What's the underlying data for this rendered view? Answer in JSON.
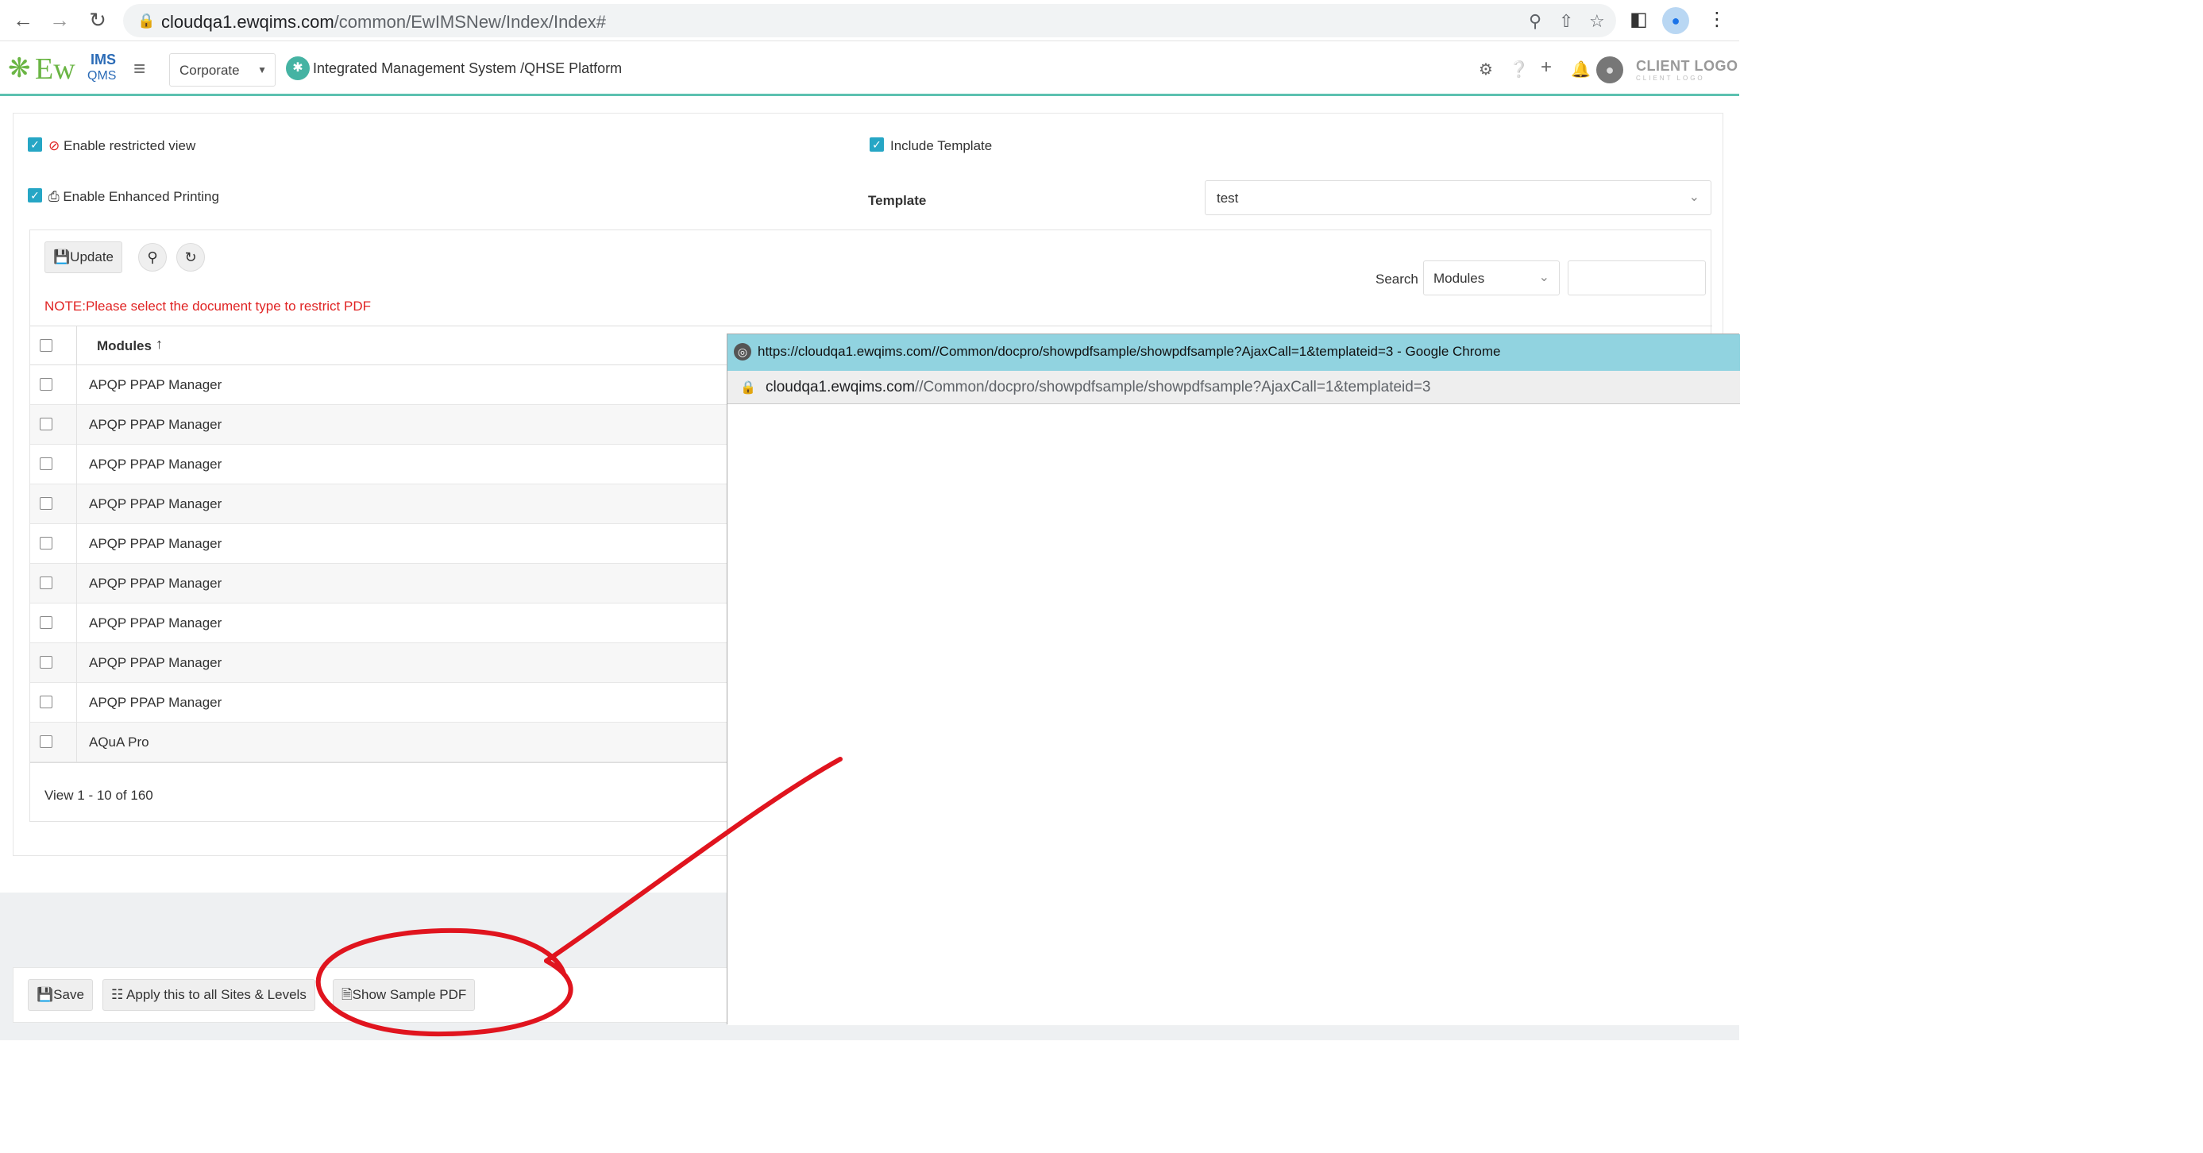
{
  "browser": {
    "url_host": "cloudqa1.ewqims.com",
    "url_path": "/common/EwIMSNew/Index/Index#"
  },
  "app": {
    "logo": {
      "ew": "Ew",
      "ims": "IMS",
      "qms": "QMS"
    },
    "entity": "Corporate",
    "platform_title": "Integrated Management System /QHSE Platform",
    "client_logo": "CLIENT LOGO",
    "client_logo_sub": "CLIENT LOGO"
  },
  "options": {
    "restricted_view": "Enable restricted view",
    "enhanced_printing": "Enable Enhanced Printing",
    "include_template": "Include Template",
    "template_label": "Template",
    "template_value": "test"
  },
  "toolbar": {
    "update": "Update",
    "note": "NOTE:Please select the document type to restrict PDF",
    "search_label": "Search",
    "search_field": "Modules",
    "search_value": ""
  },
  "table": {
    "header": "Modules",
    "rows": [
      "APQP PPAP Manager",
      "APQP PPAP Manager",
      "APQP PPAP Manager",
      "APQP PPAP Manager",
      "APQP PPAP Manager",
      "APQP PPAP Manager",
      "APQP PPAP Manager",
      "APQP PPAP Manager",
      "APQP PPAP Manager",
      "AQuA Pro"
    ],
    "pager": "View 1 - 10 of 160"
  },
  "bottom": {
    "save": "Save",
    "apply_all": "Apply this to all Sites & Levels",
    "show_sample": "Show Sample PDF"
  },
  "popup": {
    "title": "https://cloudqa1.ewqims.com//Common/docpro/showpdfsample/showpdfsample?AjaxCall=1&templateid=3 - Google Chrome",
    "url_host": "cloudqa1.ewqims.com",
    "url_path": "//Common/docpro/showpdfsample/showpdfsample?AjaxCall=1&templateid=3"
  },
  "colors": {
    "accent_teal": "#5cc1b0",
    "checkbox": "#26a6c5",
    "note_red": "#e02424",
    "annotation_red": "#e0141e",
    "popup_titlebar": "#91d3e0"
  }
}
